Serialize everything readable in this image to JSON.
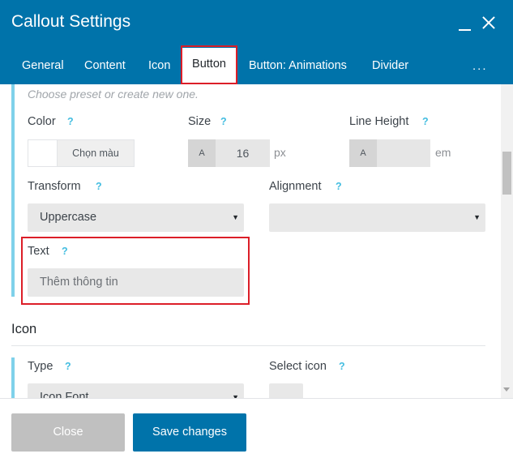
{
  "dialog": {
    "title": "Callout Settings"
  },
  "tabs": [
    {
      "label": "General"
    },
    {
      "label": "Content"
    },
    {
      "label": "Icon"
    },
    {
      "label": "Button"
    },
    {
      "label": "Button: Animations"
    },
    {
      "label": "Divider"
    }
  ],
  "tabs_more": "...",
  "active_tab": "Button",
  "button_section": {
    "hint": "Choose preset or create new one.",
    "color": {
      "label": "Color",
      "help": "?",
      "picker_label": "Chọn màu"
    },
    "size": {
      "label": "Size",
      "help": "?",
      "unit_toggle": "A",
      "value": "16",
      "unit": "px"
    },
    "line_height": {
      "label": "Line Height",
      "help": "?",
      "unit_toggle": "A",
      "value": "",
      "unit": "em"
    },
    "transform": {
      "label": "Transform",
      "help": "?",
      "value": "Uppercase"
    },
    "alignment": {
      "label": "Alignment",
      "help": "?",
      "value": ""
    },
    "text": {
      "label": "Text",
      "help": "?",
      "value": "Thêm thông tin"
    }
  },
  "icon_section": {
    "title": "Icon",
    "type": {
      "label": "Type",
      "help": "?",
      "value": "Icon Font"
    },
    "select_icon": {
      "label": "Select icon",
      "help": "?"
    }
  },
  "footer": {
    "close_label": "Close",
    "save_label": "Save changes"
  },
  "colors": {
    "header_bg": "#0073aa",
    "accent_bar": "#7fd1ea",
    "help_icon": "#43bde0",
    "highlight_box": "#dc1e28",
    "save_button": "#0073aa",
    "close_button": "#c0c0c0"
  }
}
